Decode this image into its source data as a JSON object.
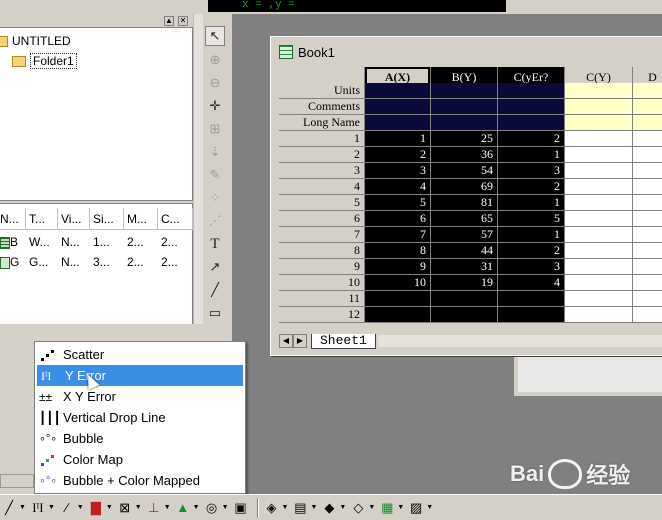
{
  "coord_bar": {
    "text": "x = ,y = "
  },
  "explorer": {
    "root_folder": "UNTITLED",
    "sub_folder": "Folder1",
    "columns": [
      "N...",
      "T...",
      "Vi...",
      "Si...",
      "M...",
      "C..."
    ],
    "rows": [
      {
        "name": "B",
        "type": "W...",
        "view": "N...",
        "size": "1...",
        "modified": "2...",
        "created": "2..."
      },
      {
        "name": "G",
        "type": "G...",
        "view": "N...",
        "size": "3...",
        "modified": "2...",
        "created": "2..."
      }
    ]
  },
  "tools": {
    "icons": [
      "pointer-icon",
      "zoom-in-icon",
      "zoom-out-icon",
      "screen-reader-icon",
      "data-selector-icon",
      "data-reader-icon",
      "draw-data-icon",
      "mask-icon",
      "region-icon",
      "text-tool-icon",
      "arrow-tool-icon",
      "line-tool-icon",
      "rectangle-tool-icon"
    ],
    "text_tool_label": "T"
  },
  "book": {
    "title": "Book1",
    "columns": [
      "A(X)",
      "B(Y)",
      "C(yEr?",
      "C(Y)",
      "D"
    ],
    "meta_rows": [
      "Units",
      "Comments",
      "Long Name"
    ],
    "row_numbers": [
      "1",
      "2",
      "3",
      "4",
      "5",
      "6",
      "7",
      "8",
      "9",
      "10",
      "11",
      "12"
    ],
    "data": [
      [
        "1",
        "25",
        "2"
      ],
      [
        "2",
        "36",
        "1"
      ],
      [
        "3",
        "54",
        "3"
      ],
      [
        "4",
        "69",
        "2"
      ],
      [
        "5",
        "81",
        "1"
      ],
      [
        "6",
        "65",
        "5"
      ],
      [
        "7",
        "57",
        "1"
      ],
      [
        "8",
        "44",
        "2"
      ],
      [
        "9",
        "31",
        "3"
      ],
      [
        "10",
        "19",
        "4"
      ],
      [
        "",
        "",
        ""
      ],
      [
        "",
        "",
        ""
      ]
    ],
    "sheet_tab": "Sheet1"
  },
  "menu": {
    "items": [
      {
        "label": "Scatter",
        "icon": "scatter-icon"
      },
      {
        "label": "Y Error",
        "icon": "y-error-icon"
      },
      {
        "label": "X Y Error",
        "icon": "xy-error-icon"
      },
      {
        "label": "Vertical Drop Line",
        "icon": "vertical-drop-line-icon"
      },
      {
        "label": "Bubble",
        "icon": "bubble-icon"
      },
      {
        "label": "Color Map",
        "icon": "color-map-icon"
      },
      {
        "label": "Bubble + Color Mapped",
        "icon": "bubble-color-mapped-icon"
      }
    ],
    "highlighted_index": 1,
    "highlight_color": "#3a8ee6"
  },
  "watermark": {
    "brand": "Bai",
    "suffix": "经验"
  }
}
